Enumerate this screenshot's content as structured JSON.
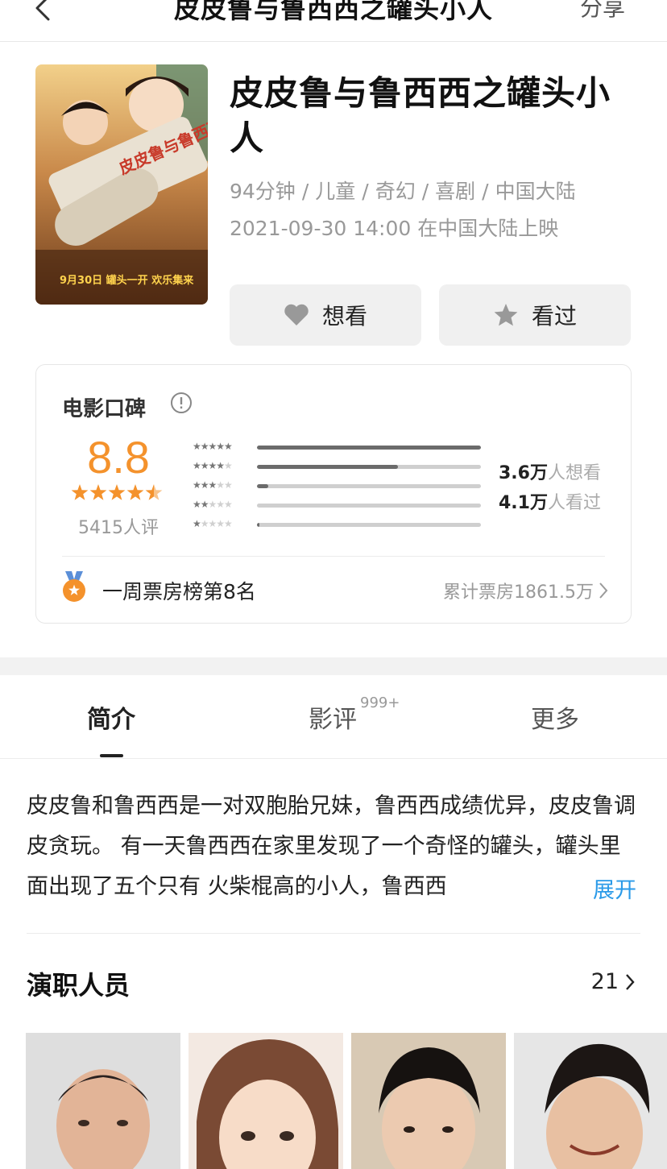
{
  "header": {
    "title": "皮皮鲁与鲁西西之罐头小人",
    "share_label": "分享"
  },
  "movie": {
    "title": "皮皮鲁与鲁西西之罐头小人",
    "duration": "94分钟",
    "genres": [
      "儿童",
      "奇幻",
      "喜剧"
    ],
    "region": "中国大陆",
    "release": "2021-09-30 14:00 在中国大陆上映",
    "poster_date_text": "9月30日 罐头一开 欢乐集来"
  },
  "actions": {
    "want_label": "想看",
    "seen_label": "看过"
  },
  "rating": {
    "card_title": "电影口碑",
    "score": "8.8",
    "score_stars": 4.5,
    "count_text": "5415人评",
    "distribution": [
      {
        "stars": 5,
        "fraction": 1.0
      },
      {
        "stars": 4,
        "fraction": 0.63
      },
      {
        "stars": 3,
        "fraction": 0.05
      },
      {
        "stars": 2,
        "fraction": 0.0
      },
      {
        "stars": 1,
        "fraction": 0.01
      }
    ],
    "want_count": "3.6万",
    "want_suffix": "人想看",
    "seen_count": "4.1万",
    "seen_suffix": "人看过",
    "rank_text": "一周票房榜第8名",
    "boxoffice_text": "累计票房1861.5万"
  },
  "tabs": [
    {
      "label": "简介",
      "badge": ""
    },
    {
      "label": "影评",
      "badge": "999+"
    },
    {
      "label": "更多",
      "badge": ""
    }
  ],
  "synopsis": {
    "text": "皮皮鲁和鲁西西是一对双胞胎兄妹，鲁西西成绩优异，皮皮鲁调皮贪玩。 有一天鲁西西在家里发现了一个奇怪的罐头，罐头里面出现了五个只有 火柴棍高的小人，鲁西西",
    "expand_label": "展开"
  },
  "cast": {
    "title": "演职人员",
    "count": "21"
  },
  "colors": {
    "accent": "#f4922c",
    "link": "#2a9ae8",
    "button_bg": "#f0f0f0"
  }
}
